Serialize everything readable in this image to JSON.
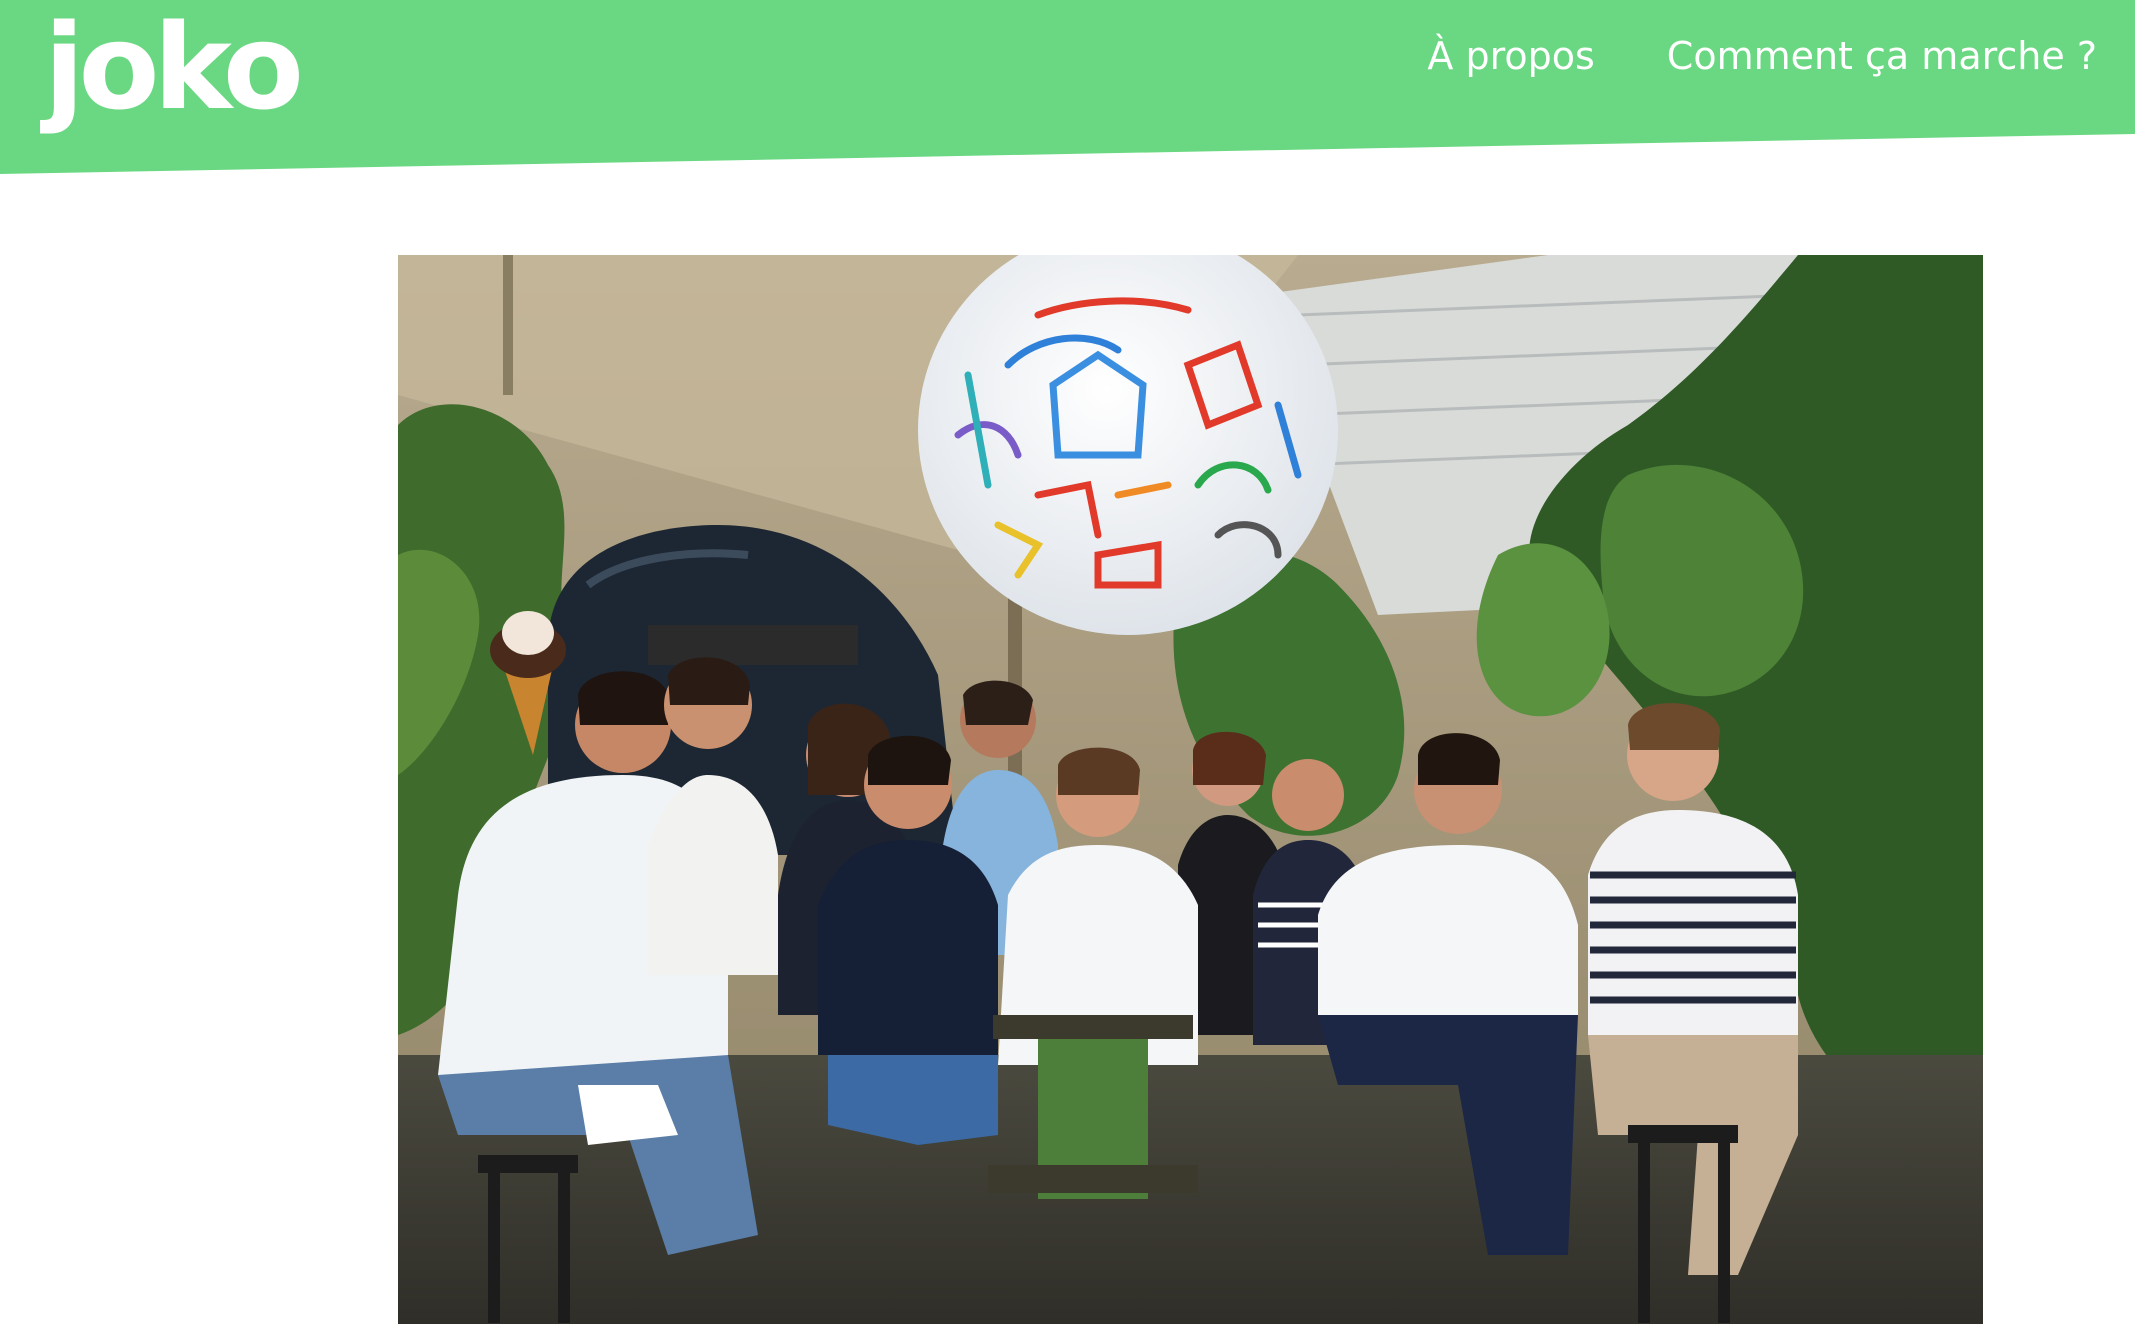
{
  "header": {
    "logo_text": "joko",
    "brand_color": "#6ad882",
    "nav": [
      {
        "label": "À propos"
      },
      {
        "label": "Comment ça marche ?"
      }
    ]
  },
  "main": {
    "photo": {
      "subject": "team-photo"
    }
  }
}
